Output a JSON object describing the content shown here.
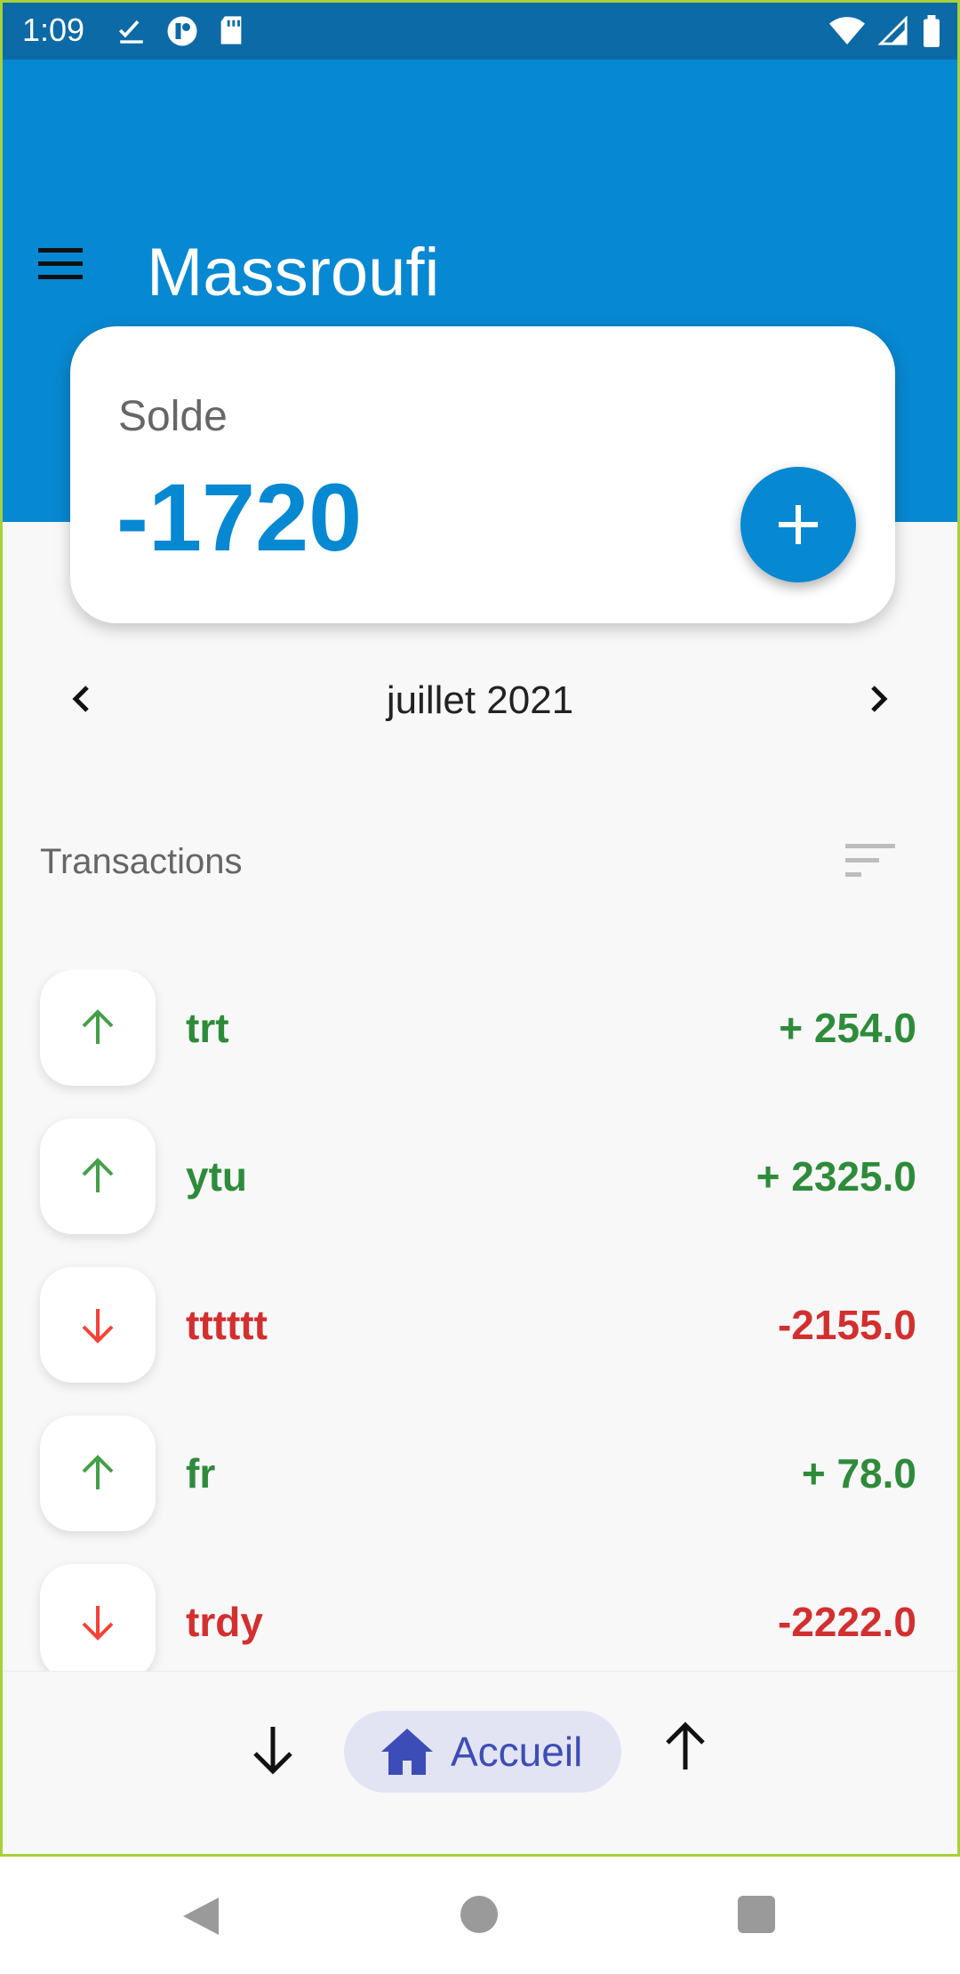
{
  "status_bar": {
    "time": "1:09",
    "left_icons": [
      "checkmark-download-icon",
      "app-notification-icon",
      "sd-card-icon"
    ],
    "right_icons": [
      "wifi-icon",
      "cell-signal-icon",
      "battery-icon"
    ]
  },
  "app_bar": {
    "title": "Massroufi",
    "menu_icon": "hamburger-menu-icon"
  },
  "balance": {
    "label": "Solde",
    "value": "-1720",
    "add_icon": "plus-icon"
  },
  "month_nav": {
    "label": "juillet 2021",
    "prev_icon": "chevron-left-icon",
    "next_icon": "chevron-right-icon"
  },
  "transactions": {
    "title": "Transactions",
    "sort_icon": "sort-icon",
    "items": [
      {
        "name": "trt",
        "amount": "+ 254.0",
        "direction": "up"
      },
      {
        "name": "ytu",
        "amount": "+ 2325.0",
        "direction": "up"
      },
      {
        "name": "tttttt",
        "amount": "-2155.0",
        "direction": "down"
      },
      {
        "name": "fr",
        "amount": "+ 78.0",
        "direction": "up"
      },
      {
        "name": "trdy",
        "amount": "-2222.0",
        "direction": "down"
      }
    ]
  },
  "bottom_nav": {
    "home_label": "Accueil",
    "left_icon": "arrow-down-icon",
    "right_icon": "arrow-up-icon",
    "home_icon": "home-icon"
  },
  "colors": {
    "primary": "#0788d2",
    "status_bar": "#0c6aa7",
    "income": "#2e8b3a",
    "expense": "#d32f2f",
    "income_arrow": "#43a047",
    "expense_arrow": "#f44336",
    "nav_accent": "#3d4db7"
  }
}
